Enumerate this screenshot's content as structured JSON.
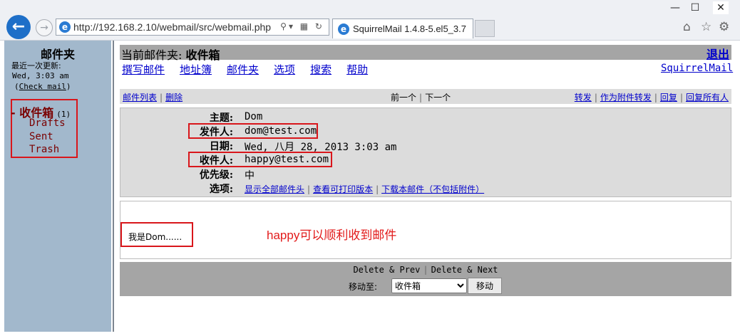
{
  "browser": {
    "url": "http://192.168.2.10/webmail/src/webmail.php",
    "tab_title": "SquirrelMail 1.4.8-5.el5_3.7",
    "win_minimize": "—",
    "win_maximize": "☐",
    "win_close": "✕",
    "back_icon": "back-arrow-icon",
    "forward_icon": "forward-arrow-icon"
  },
  "folders": {
    "title": "邮件夹",
    "last_update_label": "最近一次更新:",
    "last_update_time": "Wed, 3:03 am",
    "check_mail": "Check mail",
    "inbox": "收件箱",
    "inbox_count": "(1)",
    "items": [
      "Drafts",
      "Sent",
      "Trash"
    ]
  },
  "main": {
    "current_folder_label": "当前邮件夹:",
    "current_folder": "收件箱",
    "logout": "退出",
    "nav": [
      "撰写邮件",
      "地址簿",
      "邮件夹",
      "选项",
      "搜索",
      "帮助"
    ],
    "brand_link": "SquirrelMail",
    "toolbar": {
      "message_list": "邮件列表",
      "delete": "删除",
      "previous": "前一个",
      "next": "下一个",
      "forward": "转发",
      "forward_attach": "作为附件转发",
      "reply": "回复",
      "reply_all": "回复所有人"
    },
    "headers": {
      "subject_label": "主题:",
      "subject": "Dom",
      "from_label": "发件人:",
      "from": "dom@test.com",
      "date_label": "日期:",
      "date": "Wed, 八月 28, 2013 3:03 am",
      "to_label": "收件人:",
      "to": "happy@test.com",
      "priority_label": "优先级:",
      "priority": "中",
      "options_label": "选项:",
      "options": [
        "显示全部邮件头",
        "查看可打印版本",
        "下载本邮件（不包括附件）"
      ]
    },
    "body": "我是Dom......",
    "annotation": "happy可以顺利收到邮件",
    "bottom": {
      "delete_prev": "Delete & Prev",
      "delete_next": "Delete & Next",
      "move_to_label": "移动至:",
      "move_to_selected": "收件箱",
      "move_button": "移动"
    }
  },
  "colors": {
    "accent_red": "#d9161b",
    "link_blue": "#0000cc",
    "folder_pane": "#a2b8cc",
    "bar_gray": "#a5a5a5",
    "header_gray": "#dcdcdc"
  }
}
